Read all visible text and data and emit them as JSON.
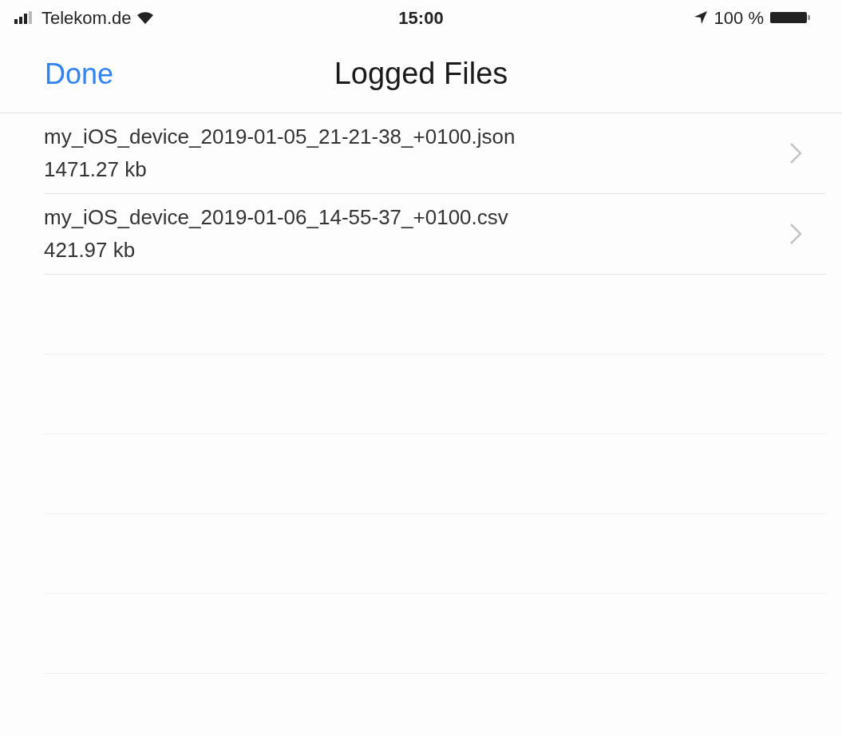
{
  "status_bar": {
    "carrier": "Telekom.de",
    "time": "15:00",
    "battery": "100 %"
  },
  "nav": {
    "done": "Done",
    "title": "Logged Files"
  },
  "files": [
    {
      "name": "my_iOS_device_2019-01-05_21-21-38_+0100.json",
      "size": "1471.27 kb"
    },
    {
      "name": "my_iOS_device_2019-01-06_14-55-37_+0100.csv",
      "size": "421.97 kb"
    }
  ]
}
